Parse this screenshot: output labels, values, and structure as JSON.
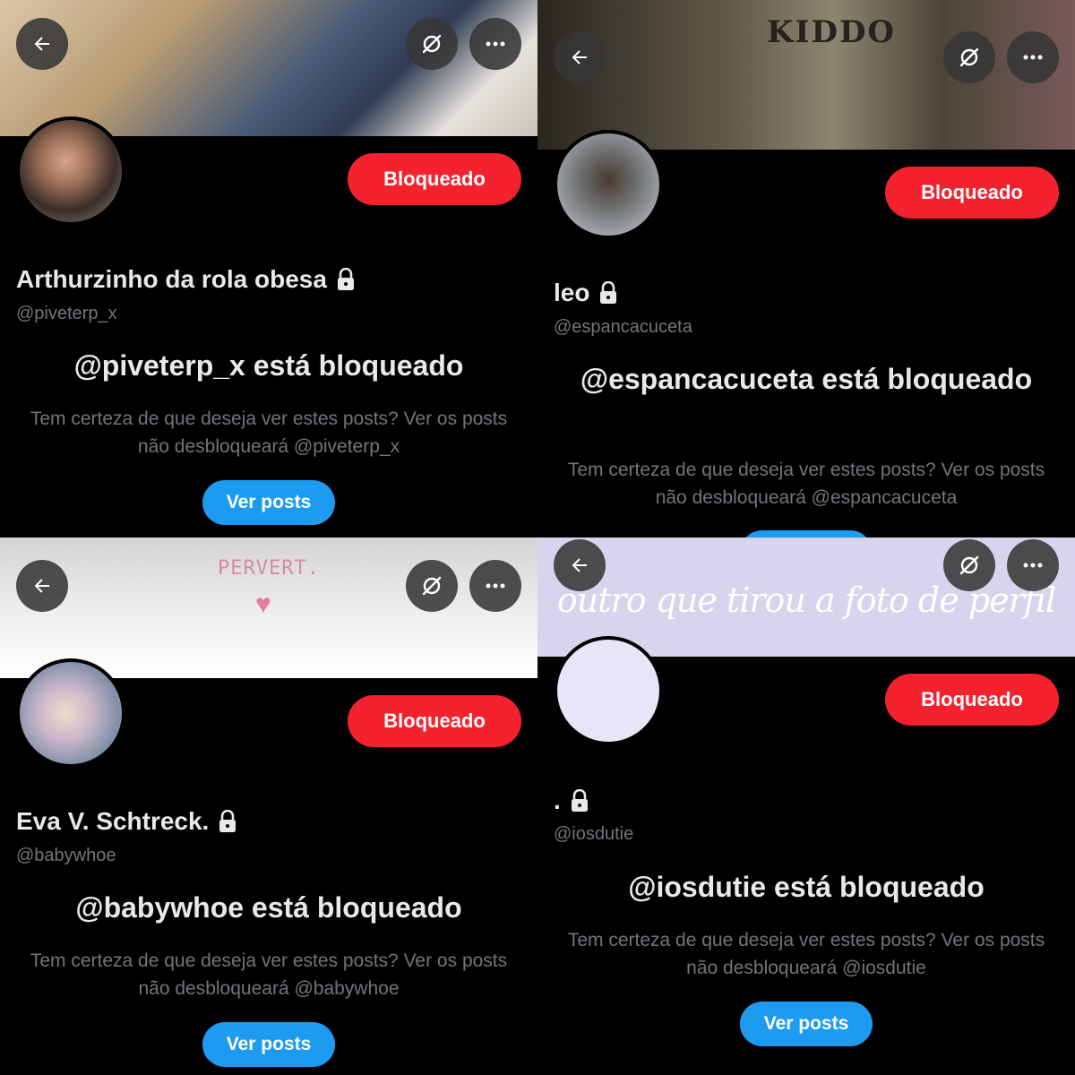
{
  "colors": {
    "background": "#000000",
    "blocked_button": "#f4212e",
    "view_button": "#1d9bf0",
    "primary_text": "#e7e9ea",
    "secondary_text": "#71767b"
  },
  "panels": [
    {
      "display_name": "Arthurzinho da rola obesa",
      "handle": "@piveterp_x",
      "blocked_label": "Bloqueado",
      "blocked_title": "@piveterp_x está bloqueado",
      "description": "Tem certeza de que deseja ver estes posts? Ver os posts não desbloqueará @piveterp_x",
      "view_posts_label": "Ver posts",
      "banner_text": ""
    },
    {
      "display_name": "leo",
      "handle": "@espancacuceta",
      "blocked_label": "Bloqueado",
      "blocked_title": "@espancacuceta está bloqueado",
      "description": "Tem certeza de que deseja ver estes posts? Ver os posts não desbloqueará @espancacuceta",
      "view_posts_label": "",
      "banner_text": "KIDDO"
    },
    {
      "display_name": "Eva V. Schtreck.",
      "handle": "@babywhoe",
      "blocked_label": "Bloqueado",
      "blocked_title": "@babywhoe está bloqueado",
      "description": "Tem certeza de que deseja ver estes posts? Ver os posts não desbloqueará @babywhoe",
      "view_posts_label": "Ver posts",
      "banner_text": "PERVERT."
    },
    {
      "display_name": ".",
      "handle": "@iosdutie",
      "blocked_label": "Bloqueado",
      "blocked_title": "@iosdutie está bloqueado",
      "description": "Tem certeza de que deseja ver estes posts? Ver os posts não desbloqueará @iosdutie",
      "view_posts_label": "Ver posts",
      "banner_text": "outro que tirou a foto de perfil"
    }
  ],
  "icons": {
    "back": "arrow-left-icon",
    "grok": "grok-icon",
    "more": "more-icon",
    "lock": "lock-icon",
    "heart": "heart-icon"
  }
}
